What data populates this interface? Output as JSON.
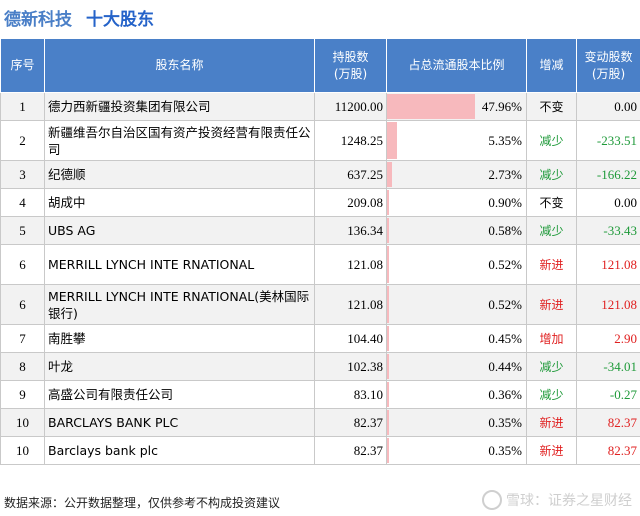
{
  "header": {
    "company": "德新科技",
    "subtitle": "十大股东"
  },
  "table": {
    "columns": [
      "序号",
      "股东名称",
      "持股数\n(万股)",
      "占总流通股本比例",
      "增减",
      "变动股数\n(万股)"
    ],
    "rows": [
      {
        "no": "1",
        "name": "德力西新疆投资集团有限公司",
        "shares": "11200.00",
        "ratio": "47.96%",
        "ratio_value": 47.96,
        "change": "不变",
        "change_type": "none",
        "delta": "0.00"
      },
      {
        "no": "2",
        "name": "新疆维吾尔自治区国有资产投资经营有限责任公司",
        "shares": "1248.25",
        "ratio": "5.35%",
        "ratio_value": 5.35,
        "change": "减少",
        "change_type": "down",
        "delta": "-233.51"
      },
      {
        "no": "3",
        "name": "纪德顺",
        "shares": "637.25",
        "ratio": "2.73%",
        "ratio_value": 2.73,
        "change": "减少",
        "change_type": "down",
        "delta": "-166.22"
      },
      {
        "no": "4",
        "name": "胡成中",
        "shares": "209.08",
        "ratio": "0.90%",
        "ratio_value": 0.9,
        "change": "不变",
        "change_type": "none",
        "delta": "0.00"
      },
      {
        "no": "5",
        "name": "UBS AG",
        "shares": "136.34",
        "ratio": "0.58%",
        "ratio_value": 0.58,
        "change": "减少",
        "change_type": "down",
        "delta": "-33.43"
      },
      {
        "no": "6",
        "name": "MERRILL LYNCH INTE RNATIONAL",
        "shares": "121.08",
        "ratio": "0.52%",
        "ratio_value": 0.52,
        "change": "新进",
        "change_type": "up",
        "delta": "121.08"
      },
      {
        "no": "6",
        "name": "MERRILL LYNCH INTE RNATIONAL(美林国际银行)",
        "shares": "121.08",
        "ratio": "0.52%",
        "ratio_value": 0.52,
        "change": "新进",
        "change_type": "up",
        "delta": "121.08"
      },
      {
        "no": "7",
        "name": "南胜攀",
        "shares": "104.40",
        "ratio": "0.45%",
        "ratio_value": 0.45,
        "change": "增加",
        "change_type": "up",
        "delta": "2.90"
      },
      {
        "no": "8",
        "name": "叶龙",
        "shares": "102.38",
        "ratio": "0.44%",
        "ratio_value": 0.44,
        "change": "减少",
        "change_type": "down",
        "delta": "-34.01"
      },
      {
        "no": "9",
        "name": "高盛公司有限责任公司",
        "shares": "83.10",
        "ratio": "0.36%",
        "ratio_value": 0.36,
        "change": "减少",
        "change_type": "down",
        "delta": "-0.27"
      },
      {
        "no": "10",
        "name": "BARCLAYS BANK PLC",
        "shares": "82.37",
        "ratio": "0.35%",
        "ratio_value": 0.35,
        "change": "新进",
        "change_type": "up",
        "delta": "82.37"
      },
      {
        "no": "10",
        "name": "Barclays bank plc",
        "shares": "82.37",
        "ratio": "0.35%",
        "ratio_value": 0.35,
        "change": "新进",
        "change_type": "up",
        "delta": "82.37"
      }
    ]
  },
  "footer": {
    "source": "数据来源：公开数据整理，仅供参考不构成投资建议",
    "logo": "雪球：证券之星财经"
  },
  "colors": {
    "header_bg": "#4a80c8",
    "bar": "#f7b9bd",
    "up": "#e02020",
    "down": "#1f9a3a",
    "title": "#2563c9"
  }
}
